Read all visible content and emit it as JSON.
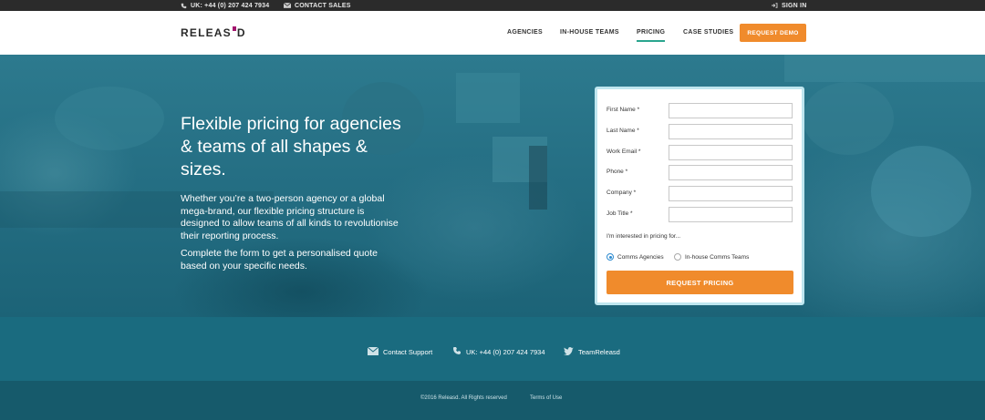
{
  "topbar": {
    "phone": "UK: +44 (0) 207 424 7934",
    "contact_sales": "CONTACT SALES",
    "sign_in": "SIGN IN"
  },
  "header": {
    "logo_left": "RELEAS",
    "logo_right": "D",
    "nav": [
      "AGENCIES",
      "IN-HOUSE TEAMS",
      "PRICING",
      "CASE STUDIES"
    ],
    "active_nav": "PRICING",
    "demo_button": "REQUEST DEMO"
  },
  "hero": {
    "title": "Flexible pricing for agencies & teams of all shapes & sizes.",
    "paragraph_1": "Whether you’re a two-person agency or a global mega-brand, our flexible pricing structure is designed to allow teams of all kinds to revolutionise their reporting process.",
    "paragraph_2": "Complete the form to get a personalised quote based on your specific needs."
  },
  "form": {
    "fields": [
      {
        "label": "First Name *",
        "value": ""
      },
      {
        "label": "Last Name *",
        "value": ""
      },
      {
        "label": "Work Email *",
        "value": ""
      },
      {
        "label": "Phone *",
        "value": ""
      },
      {
        "label": "Company *",
        "value": ""
      },
      {
        "label": "Job Title *",
        "value": ""
      }
    ],
    "interest_label": "I'm interested in pricing for...",
    "options": [
      {
        "label": "Comms Agencies",
        "selected": true
      },
      {
        "label": "In-house Comms Teams",
        "selected": false
      }
    ],
    "submit_label": "REQUEST PRICING"
  },
  "contact": {
    "support": "Contact Support",
    "phone": "UK: +44 (0) 207 424 7934",
    "twitter": "TeamReleasd"
  },
  "footer": {
    "copyright": "©2016 Releasd. All Rights reserved",
    "terms": "Terms of Use"
  },
  "colors": {
    "accent_orange": "#f08b2c",
    "teal": "#1a6b7f",
    "logo_magenta": "#a3156e",
    "nav_active_underline": "#2aa58e"
  }
}
